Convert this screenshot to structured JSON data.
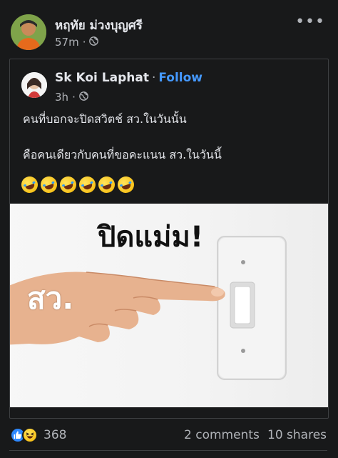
{
  "post": {
    "author": "หฤทัย ม่วงบุญศรี",
    "time": "57m",
    "privacy_icon": "globe-icon",
    "more_icon": "more-options-icon",
    "more_label": "•••"
  },
  "shared": {
    "author": "Sk Koi Laphat",
    "separator": "·",
    "follow_label": "Follow",
    "time": "3h",
    "privacy_icon": "globe-icon",
    "line1": "คนที่บอกจะปิดสวิตช์ สว.ในวันนั้น",
    "line2": "คือคนเดียวกับคนที่ขอคะแนน สว.ในวันนี้",
    "emojis": [
      "rolling-on-floor-laughing",
      "rolling-on-floor-laughing",
      "rolling-on-floor-laughing",
      "rolling-on-floor-laughing",
      "rolling-on-floor-laughing",
      "rolling-on-floor-laughing"
    ]
  },
  "meme": {
    "caption": "ปิดแม่ม!",
    "hand_label": "สว."
  },
  "footer": {
    "reaction_icons": [
      "like-icon",
      "haha-icon"
    ],
    "reaction_count": "368",
    "comments": "2 comments",
    "shares": "10 shares"
  },
  "colors": {
    "background": "#18191a",
    "text_primary": "#e4e6eb",
    "text_secondary": "#b0b3b8",
    "follow_link": "#4599ff",
    "like_blue": "#2d88ff"
  }
}
